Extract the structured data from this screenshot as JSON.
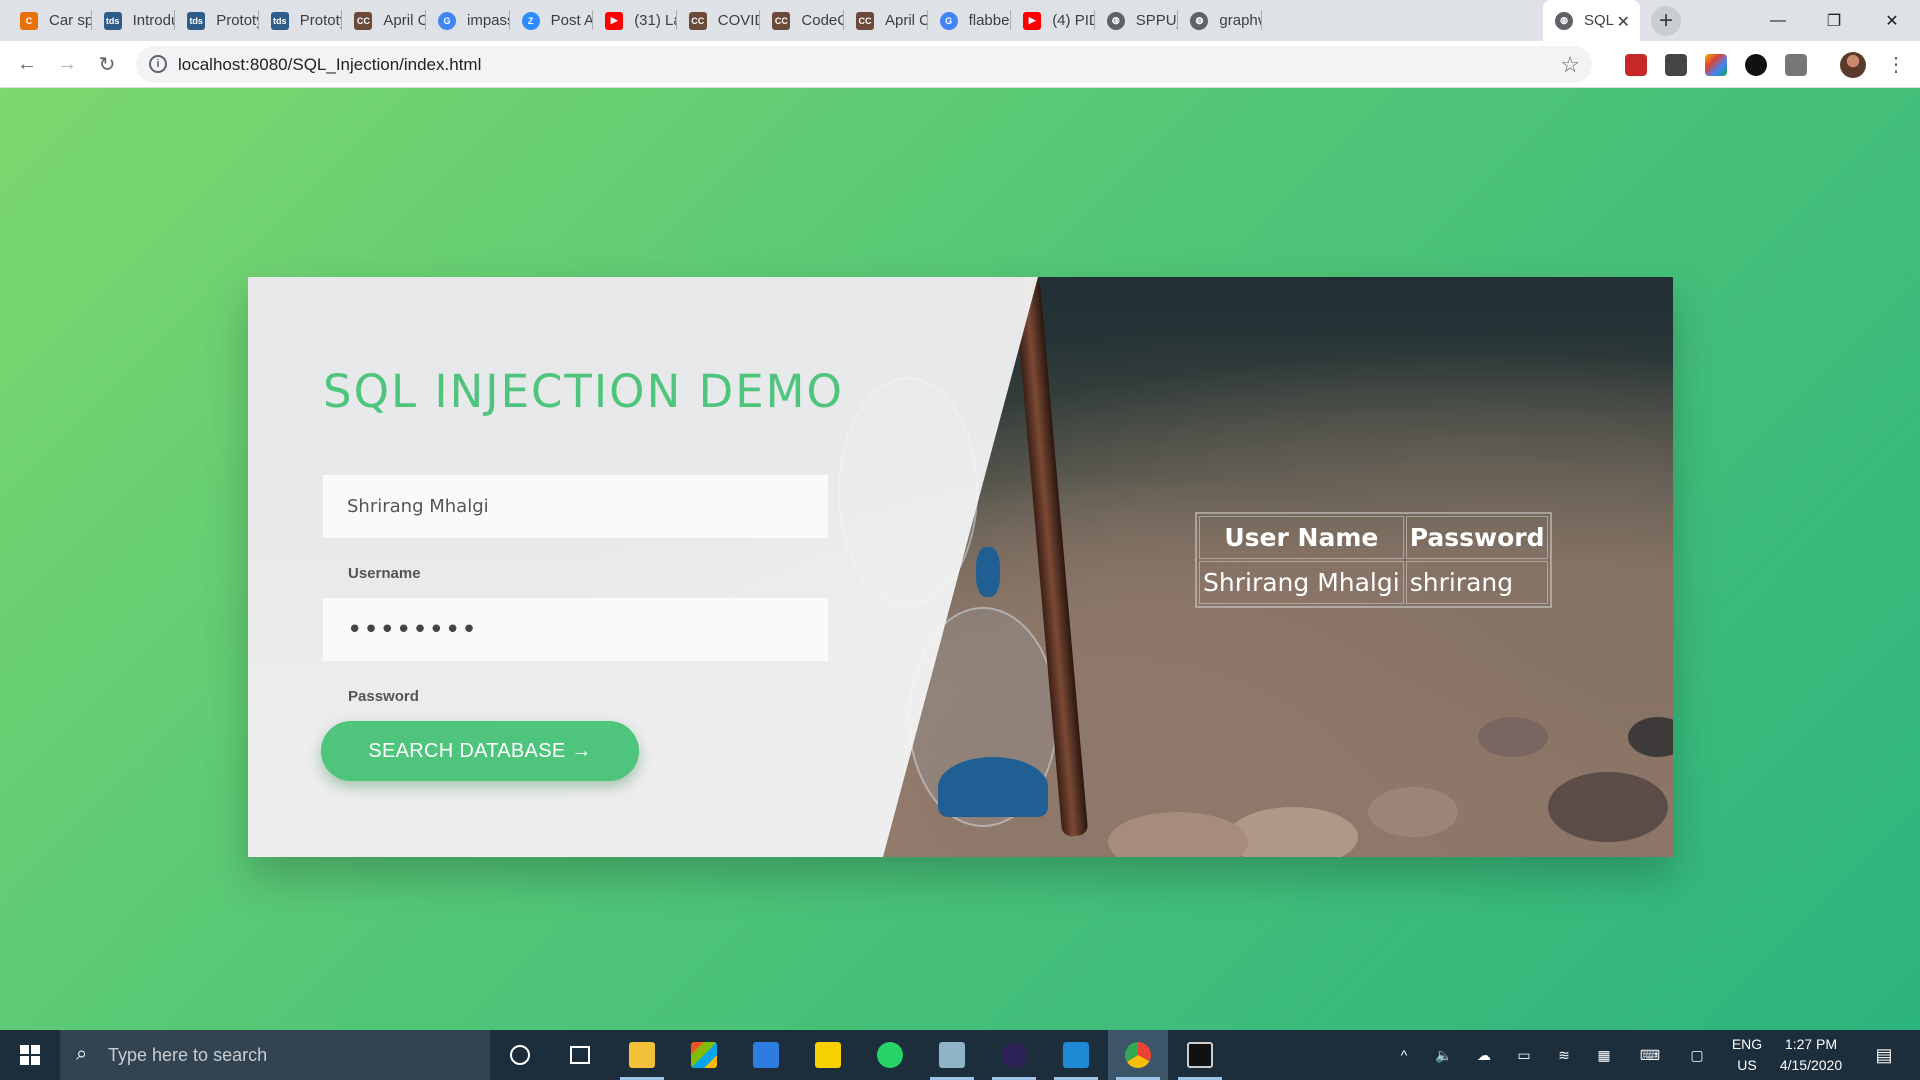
{
  "browser": {
    "tabs": [
      {
        "title": "Car spe",
        "color": "#e8710a",
        "glyph": "C"
      },
      {
        "title": "Introdu",
        "color": "#2f5d8a",
        "glyph": "tds"
      },
      {
        "title": "Prototy",
        "color": "#2f5d8a",
        "glyph": "tds"
      },
      {
        "title": "Prototy",
        "color": "#2f5d8a",
        "glyph": "tds"
      },
      {
        "title": "April Ch",
        "color": "#6b4a3a",
        "glyph": "CC"
      },
      {
        "title": "impasse",
        "color": "#4285f4",
        "glyph": "G"
      },
      {
        "title": "Post Att",
        "color": "#2d8cff",
        "glyph": "Z"
      },
      {
        "title": "(31) La",
        "color": "#ff0000",
        "glyph": "▶"
      },
      {
        "title": "COVID",
        "color": "#6b4a3a",
        "glyph": "CC"
      },
      {
        "title": "CodeCh",
        "color": "#6b4a3a",
        "glyph": "CC"
      },
      {
        "title": "April Ch",
        "color": "#6b4a3a",
        "glyph": "CC"
      },
      {
        "title": "flabberg",
        "color": "#4285f4",
        "glyph": "G"
      },
      {
        "title": "(4) PID",
        "color": "#ff0000",
        "glyph": "▶"
      },
      {
        "title": "SPPU_B",
        "color": "#5f6368",
        "glyph": "◍"
      },
      {
        "title": "graphvi",
        "color": "#5f6368",
        "glyph": "◍"
      }
    ],
    "active_tab": {
      "title": "SQL",
      "close_glyph": "✕"
    },
    "new_tab_glyph": "+",
    "window_controls": {
      "minimize": "—",
      "maximize": "❐",
      "close": "✕"
    },
    "nav": {
      "back": "←",
      "forward": "→",
      "reload": "↻"
    },
    "url": "localhost:8080/SQL_Injection/index.html",
    "star_glyph": "☆",
    "menu_glyph": "⋮",
    "extensions": [
      "#c62828",
      "#444444",
      "#f4b400",
      "#111111",
      "#777777"
    ]
  },
  "page": {
    "title": "SQL INJECTION DEMO",
    "username_value": "Shrirang Mhalgi",
    "username_label": "Username",
    "password_value": "••••••••",
    "password_label": "Password",
    "search_button": "SEARCH DATABASE →",
    "results": {
      "headers": [
        "User Name",
        "Password"
      ],
      "rows": [
        [
          "Shrirang Mhalgi",
          "shrirang"
        ]
      ]
    }
  },
  "taskbar": {
    "search_placeholder": "Type here to search",
    "search_glyph": "⌕",
    "language": [
      "ENG",
      "US"
    ],
    "time": "1:27 PM",
    "date": "4/15/2020",
    "tray_glyphs": [
      "^",
      "🔈",
      "☁",
      "▭",
      "≋",
      "▦",
      "⌨",
      "▢"
    ],
    "notification_glyph": "▤"
  }
}
